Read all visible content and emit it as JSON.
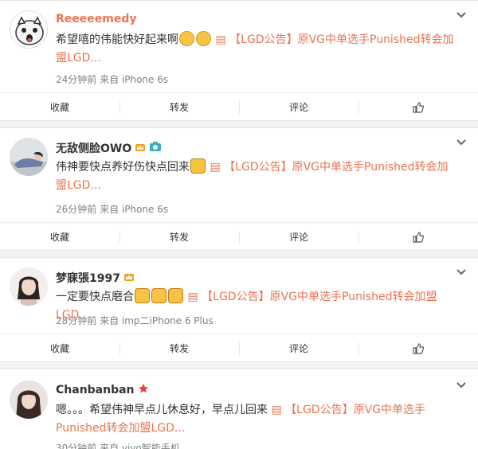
{
  "comments": [
    {
      "user": "Reeeeemedy",
      "text": "希望嘻的伟能快好起来啊",
      "link_prefix": "【LGD公告】原VG中单选手Punished转会加盟",
      "link_tail": "LGD...",
      "meta": "24分钟前  来自 iPhone 6s"
    },
    {
      "user": "无敌侧脸OWO",
      "text": "伟神要快点养好伤快点回来",
      "link_prefix": "【LGD公告】原VG中单选手Punished转会加盟",
      "link_tail": "LGD...",
      "meta": "26分钟前  来自 iPhone 6s"
    },
    {
      "user": "梦寐張1997",
      "text": "一定要快点磨合",
      "link_prefix": "【LGD公告】原VG中单选手Punished转会加盟LGD...",
      "link_tail": "",
      "meta": "28分钟前  来自 imp二iPhone 6 Plus"
    },
    {
      "user": "Chanbanban",
      "text": "嗯。。。希望伟神早点儿休息好，早点儿回来",
      "link_prefix": "【LGD公告】原VG中单选手",
      "link_tail": "Punished转会加盟LGD...",
      "meta": "30分钟前  来自 vivo智能手机"
    }
  ],
  "actions": {
    "favorite": "收藏",
    "repost": "转发",
    "comment": "评论"
  },
  "colors": {
    "link": "#eb7350",
    "text": "#333333",
    "meta": "#808080",
    "background": "#f2f2f2"
  },
  "icons": {
    "link_marker": "link-doc-icon",
    "like": "thumbs-up-icon",
    "menu": "chevron-down-icon"
  }
}
